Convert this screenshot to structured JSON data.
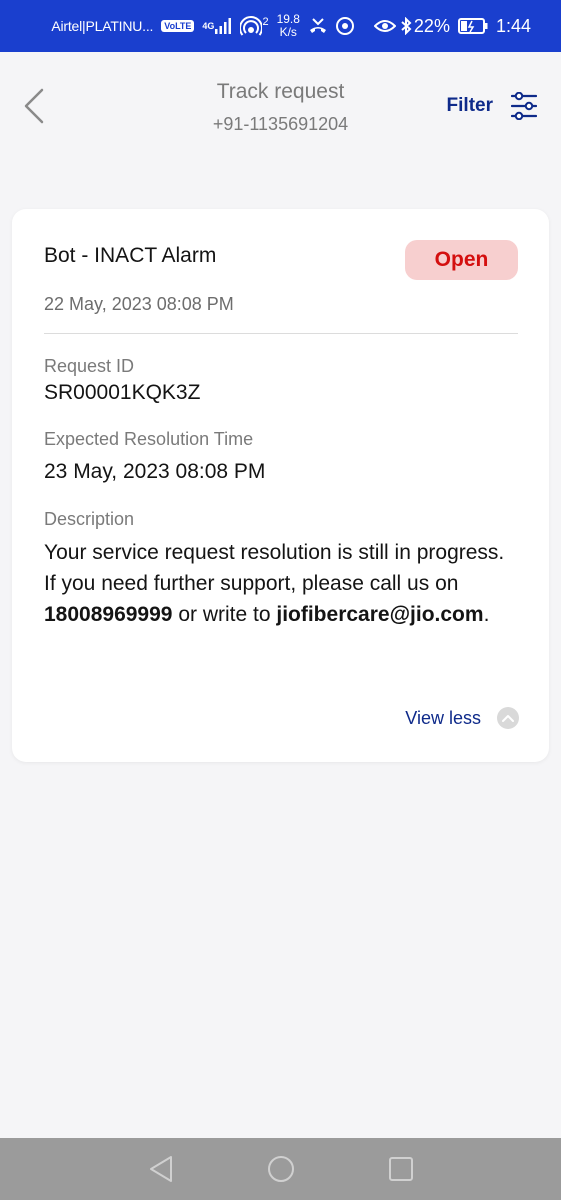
{
  "status_bar": {
    "carrier": "Airtel|PLATINU...",
    "volte": "VoLTE",
    "network": "4G",
    "hotspot_count": "2",
    "speed_value": "19.8",
    "speed_unit": "K/s",
    "battery": "22%",
    "time": "1:44"
  },
  "header": {
    "title": "Track request",
    "subtitle": "+91-1135691204",
    "filter_label": "Filter"
  },
  "card": {
    "title": "Bot - INACT Alarm",
    "status": "Open",
    "date": "22 May, 2023 08:08 PM",
    "request_id_label": "Request ID",
    "request_id": "SR00001KQK3Z",
    "resolution_label": "Expected Resolution Time",
    "resolution_time": "23 May, 2023 08:08 PM",
    "description_label": "Description",
    "description_part1": "Your service request resolution is still in progress. If you need further support, please call us on ",
    "phone": "18008969999",
    "description_part2": " or write to ",
    "email": "jiofibercare@jio.com",
    "description_part3": ".",
    "view_less": "View less"
  },
  "colors": {
    "status_bar": "#1a3fce",
    "accent": "#0e2a8a",
    "badge_bg": "#f7cfcf",
    "badge_text": "#d40f0f"
  }
}
